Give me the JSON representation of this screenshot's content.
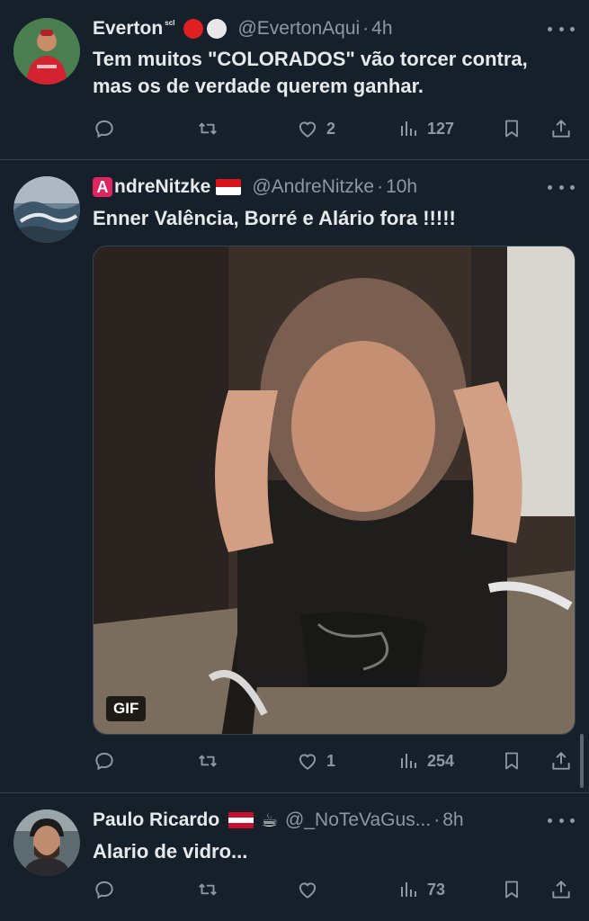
{
  "tweets": [
    {
      "name": "Everton",
      "name_suffix": "ˢᶜᴵ",
      "name_emoji": "🔴⚪",
      "handle": "@EvertonAqui",
      "time": "4h",
      "text": "Tem muitos \"COLORADOS\" vão torcer contra, mas os de verdade querem ganhar.",
      "replies": "",
      "retweets": "",
      "likes": "2",
      "views": "127"
    },
    {
      "name": "ndreNitzke",
      "name_prefix_badge": "A",
      "handle": "@AndreNitzke",
      "time": "10h",
      "text": "Enner Valência, Borré e Alário fora !!!!!",
      "media_label": "GIF",
      "replies": "",
      "retweets": "",
      "likes": "1",
      "views": "254"
    },
    {
      "name": "Paulo Ricardo",
      "name_emoji": "☕",
      "handle": "@_NoTeVaGus...",
      "time": "8h",
      "text": "Alario de vidro...",
      "replies": "",
      "retweets": "",
      "likes": "",
      "views": "73"
    }
  ],
  "icons": {
    "reply": "reply-icon",
    "retweet": "retweet-icon",
    "like": "heart-icon",
    "views": "views-icon",
    "bookmark": "bookmark-icon",
    "share": "share-icon",
    "more": "more-icon"
  },
  "colors": {
    "background": "#15202b",
    "text": "#e7e9ea",
    "secondary": "#8b98a5",
    "separator": "#38444d"
  }
}
